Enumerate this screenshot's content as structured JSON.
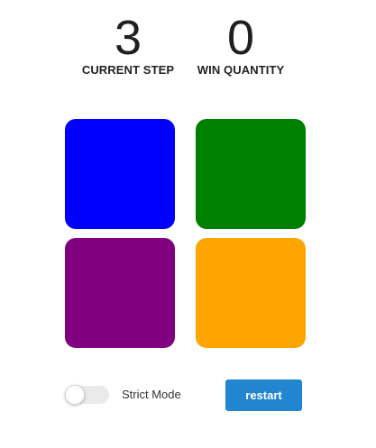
{
  "stats": {
    "current_step": {
      "value": "3",
      "label": "CURRENT STEP"
    },
    "win_quantity": {
      "value": "0",
      "label": "WIN QUANTITY"
    }
  },
  "pads": [
    {
      "name": "blue",
      "color": "#0000ff"
    },
    {
      "name": "green",
      "color": "#008000"
    },
    {
      "name": "purple",
      "color": "#800080"
    },
    {
      "name": "orange",
      "color": "#ffa500"
    }
  ],
  "strict_mode": {
    "label": "Strict Mode",
    "enabled": false
  },
  "restart": {
    "label": "restart",
    "color": "#2185d0"
  }
}
